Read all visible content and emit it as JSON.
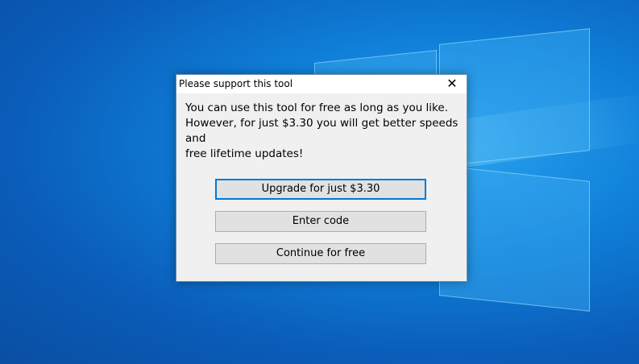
{
  "dialog": {
    "title": "Please support this tool",
    "close_glyph": "✕",
    "message_lines": [
      "You can use this tool for free as long as you like.",
      "However, for just $3.30 you will get better speeds and",
      "free lifetime updates!"
    ],
    "buttons": {
      "upgrade": "Upgrade for just $3.30",
      "enter_code": "Enter code",
      "continue_free": "Continue for free"
    }
  },
  "colors": {
    "accent": "#0078d7",
    "dialog_bg": "#f0f0f0",
    "button_bg": "#e1e1e1"
  }
}
